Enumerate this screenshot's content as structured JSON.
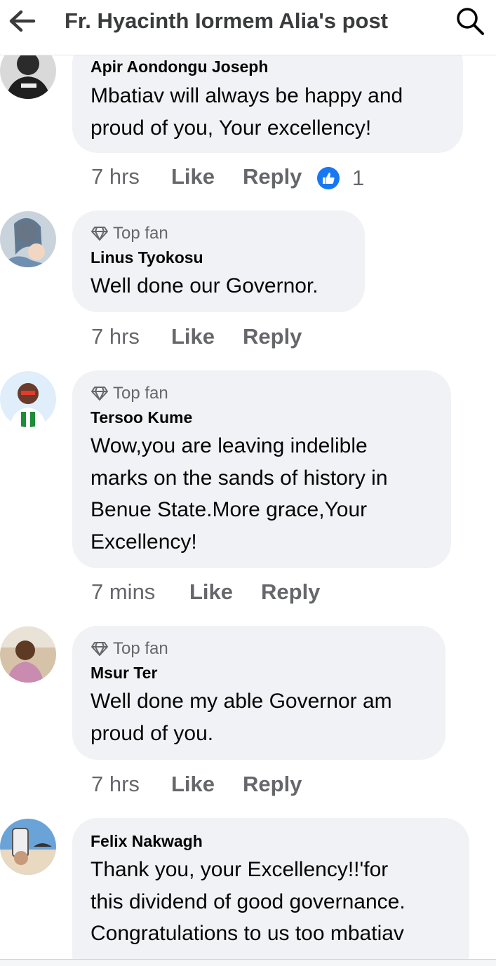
{
  "header": {
    "title": "Fr. Hyacinth Iormem Alia's post",
    "back_icon": "arrow-left-icon",
    "search_icon": "search-icon"
  },
  "labels": {
    "top_fan": "Top fan",
    "like": "Like",
    "reply": "Reply"
  },
  "comments": [
    {
      "author": "Apir Aondongu Joseph",
      "top_fan": false,
      "lines": [
        "Mbatiav will always be happy and",
        "proud of you, Your excellency!"
      ],
      "time": "7 hrs",
      "reaction_count": "1"
    },
    {
      "author": "Linus Tyokosu",
      "top_fan": true,
      "lines": [
        "Well done our Governor."
      ],
      "time": "7 hrs"
    },
    {
      "author": "Tersoo Kume",
      "top_fan": true,
      "lines": [
        "Wow,you are leaving indelible",
        "marks on the sands of history in",
        "Benue State.More grace,Your",
        "Excellency!"
      ],
      "time": "7 mins"
    },
    {
      "author": "Msur Ter",
      "top_fan": true,
      "lines": [
        "Well done my able Governor am",
        "proud of you."
      ],
      "time": "7 hrs"
    },
    {
      "author": "Felix Nakwagh",
      "top_fan": false,
      "lines": [
        "Thank you, your Excellency!!'for",
        "this dividend of good governance.",
        "Congratulations to us too mbatiav"
      ]
    }
  ],
  "colors": {
    "bubble": "#f0f2f5",
    "secondary_text": "#65676b",
    "like_blue": "#1877f2"
  }
}
